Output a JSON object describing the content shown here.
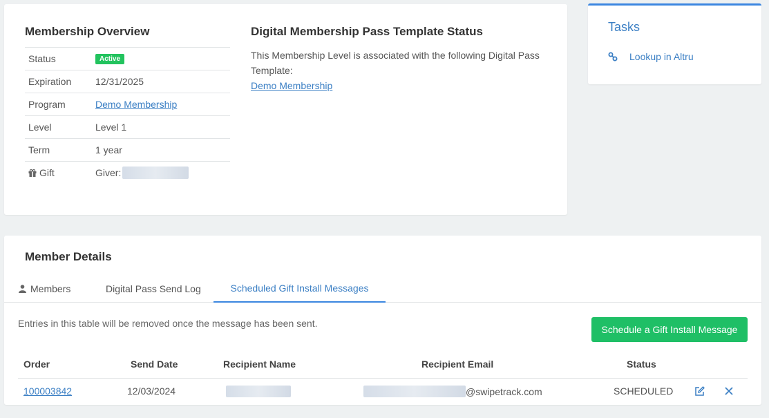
{
  "overview": {
    "title": "Membership Overview",
    "rows": [
      {
        "label": "Status",
        "value": "Active"
      },
      {
        "label": "Expiration",
        "value": "12/31/2025"
      },
      {
        "label": "Program",
        "value": "Demo Membership"
      },
      {
        "label": "Level",
        "value": "Level 1"
      },
      {
        "label": "Term",
        "value": "1 year"
      },
      {
        "label": "Gift",
        "value": "Giver:"
      }
    ]
  },
  "pass": {
    "title": "Digital Membership Pass Template Status",
    "desc": "This Membership Level is associated with the following Digital Pass Template:",
    "link": "Demo Membership"
  },
  "tasks": {
    "title": "Tasks",
    "items": [
      {
        "label": "Lookup in Altru",
        "icon": "link-icon"
      }
    ]
  },
  "member_details": {
    "title": "Member Details",
    "tabs": [
      "Members",
      "Digital Pass Send Log",
      "Scheduled Gift Install Messages"
    ],
    "active_tab": "Scheduled Gift Install Messages",
    "info": "Entries in this table will be removed once the message has been sent.",
    "button": "Schedule a Gift Install Message",
    "columns": [
      "Order",
      "Send Date",
      "Recipient Name",
      "Recipient Email",
      "Status"
    ],
    "rows": [
      {
        "order": "100003842",
        "send_date": "12/03/2024",
        "email_domain": "@swipetrack.com",
        "status": "SCHEDULED"
      }
    ]
  },
  "colors": {
    "accent": "#3b86e0",
    "link": "#3b7fc4",
    "success": "#1fbf66"
  }
}
